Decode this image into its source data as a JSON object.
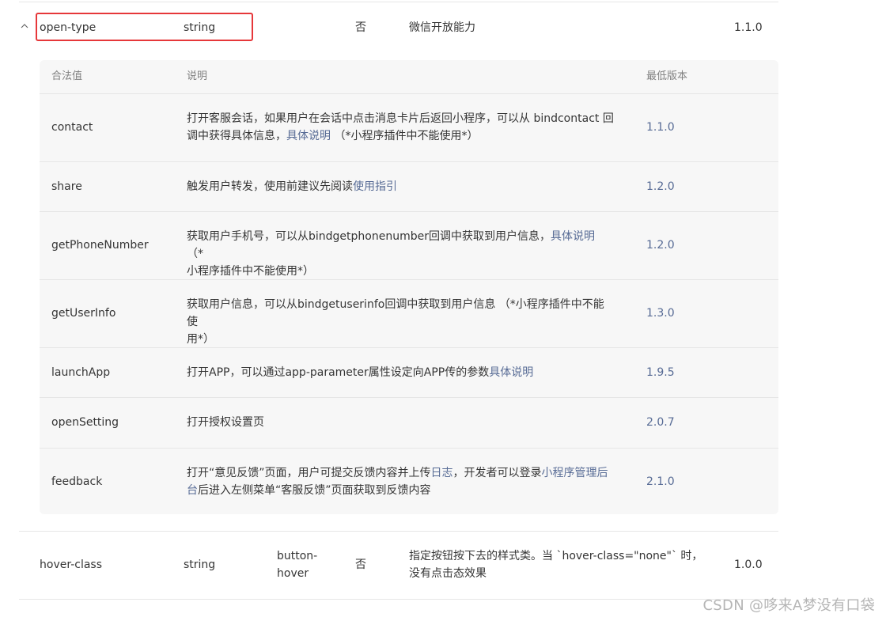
{
  "top_row": {
    "name": "open-type",
    "type": "string",
    "required": "否",
    "description": "微信开放能力",
    "version": "1.1.0"
  },
  "sub_table": {
    "headers": {
      "value": "合法值",
      "description": "说明",
      "min_version": "最低版本"
    },
    "rows": [
      {
        "value": "contact",
        "desc_line1": "打开客服会话，如果用户在会话中点击消息卡片后返回小程序，可以从 bindcontact 回",
        "desc_line2_pre": "调中获得具体信息，",
        "desc_link": "具体说明",
        "desc_line2_post": " （*小程序插件中不能使用*）",
        "version": "1.1.0"
      },
      {
        "value": "share",
        "desc_pre": "触发用户转发，使用前建议先阅读",
        "desc_link": "使用指引",
        "version": "1.2.0"
      },
      {
        "value": "getPhoneNumber",
        "desc_line1_pre": "获取用户手机号，可以从bindgetphonenumber回调中获取到用户信息，",
        "desc_link": "具体说明",
        "desc_line1_post": " （*",
        "desc_line2": "小程序插件中不能使用*）",
        "version": "1.2.0"
      },
      {
        "value": "getUserInfo",
        "desc_line1": "获取用户信息，可以从bindgetuserinfo回调中获取到用户信息 （*小程序插件中不能使",
        "desc_line2": "用*）",
        "version": "1.3.0"
      },
      {
        "value": "launchApp",
        "desc_pre": "打开APP，可以通过app-parameter属性设定向APP传的参数",
        "desc_link": "具体说明",
        "version": "1.9.5"
      },
      {
        "value": "openSetting",
        "desc": "打开授权设置页",
        "version": "2.0.7"
      },
      {
        "value": "feedback",
        "desc_line1_pre": "打开“意见反馈”页面，用户可提交反馈内容并上传",
        "desc_link1": "日志",
        "desc_line1_mid": "，开发者可以登录",
        "desc_link2_a": "小程序管理后",
        "desc_link2_b": "台",
        "desc_line2_post": "后进入左侧菜单“客服反馈”页面获取到反馈内容",
        "version": "2.1.0"
      }
    ]
  },
  "bottom_row": {
    "name": "hover-class",
    "type": "string",
    "default_line1": "button-",
    "default_line2": "hover",
    "required": "否",
    "desc_line1": "指定按钮按下去的样式类。当 `hover-class=\"none\"` 时，",
    "desc_line2": "没有点击态效果",
    "version": "1.0.0"
  },
  "watermark": "CSDN @哆来A梦没有口袋",
  "colors": {
    "link": "#576b95",
    "highlight": "#e6373a",
    "sub_table_bg": "#f7f7f7"
  }
}
